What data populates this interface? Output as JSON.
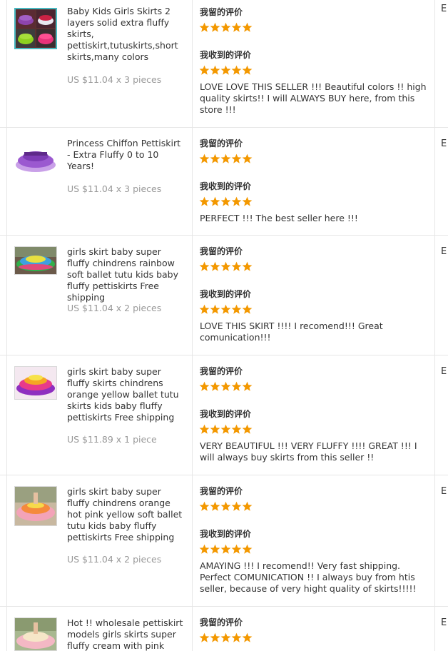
{
  "colors": {
    "star": "#f39800",
    "divider": "#e6e6e6",
    "text": "#333333",
    "price": "#999999"
  },
  "icons": {
    "star": "star-icon"
  },
  "orders": [
    {
      "title": "Baby Kids Girls Skirts 2 layers solid extra fluffy skirts, pettiskirt,tutuskirts,short skirts,many colors",
      "price": "US $11.04 x 3 pieces",
      "my_review_label": "我留的评价",
      "my_rating": 5,
      "received_review_label": "我收到的评价",
      "received_rating": 5,
      "comment": "LOVE LOVE THIS SELLER !!! Beautiful colors !! high quality skirts!! I will ALWAYS BUY here, from this store !!!",
      "edge_text": "E"
    },
    {
      "title": "Princess Chiffon Pettiskirt - Extra Fluffy 0 to 10 Years!",
      "price": "US $11.04 x 3 pieces",
      "my_review_label": "我留的评价",
      "my_rating": 5,
      "received_review_label": "我收到的评价",
      "received_rating": 5,
      "comment": "PERFECT !!! The best seller here !!!",
      "edge_text": "E"
    },
    {
      "title": "girls skirt baby super fluffy chindrens rainbow soft ballet tutu kids baby fluffy pettiskirts Free shipping",
      "price": "US $11.04 x 2 pieces",
      "my_review_label": "我留的评价",
      "my_rating": 5,
      "received_review_label": "我收到的评价",
      "received_rating": 5,
      "comment": "LOVE THIS SKIRT !!!! I recomend!!! Great comunication!!!",
      "edge_text": "E"
    },
    {
      "title": "girls skirt baby super fluffy skirts chindrens orange yellow ballet tutu skirts kids baby fluffy pettiskirts Free shipping",
      "price": "US $11.89 x 1 piece",
      "my_review_label": "我留的评价",
      "my_rating": 5,
      "received_review_label": "我收到的评价",
      "received_rating": 5,
      "comment": "VERY BEAUTIFUL !!! VERY FLUFFY !!!! GREAT !!! I will always buy skirts from this seller !!",
      "edge_text": "E"
    },
    {
      "title": "girls skirt baby super fluffy chindrens orange hot pink yellow soft ballet tutu kids baby fluffy pettiskirts Free shipping",
      "price": "US $11.04 x 2 pieces",
      "my_review_label": "我留的评价",
      "my_rating": 5,
      "received_review_label": "我收到的评价",
      "received_rating": 5,
      "comment": "AMAYING !!! I recomend!! Very fast shipping. Perfect COMUNICATION !! I always buy from htis seller, because of very hight quality of skirts!!!!!",
      "edge_text": "E"
    },
    {
      "title": "Hot !! wholesale pettiskirt models girls skirts super fluffy cream with pink",
      "my_review_label": "我留的评价",
      "my_rating": 5,
      "edge_text": "E"
    }
  ]
}
